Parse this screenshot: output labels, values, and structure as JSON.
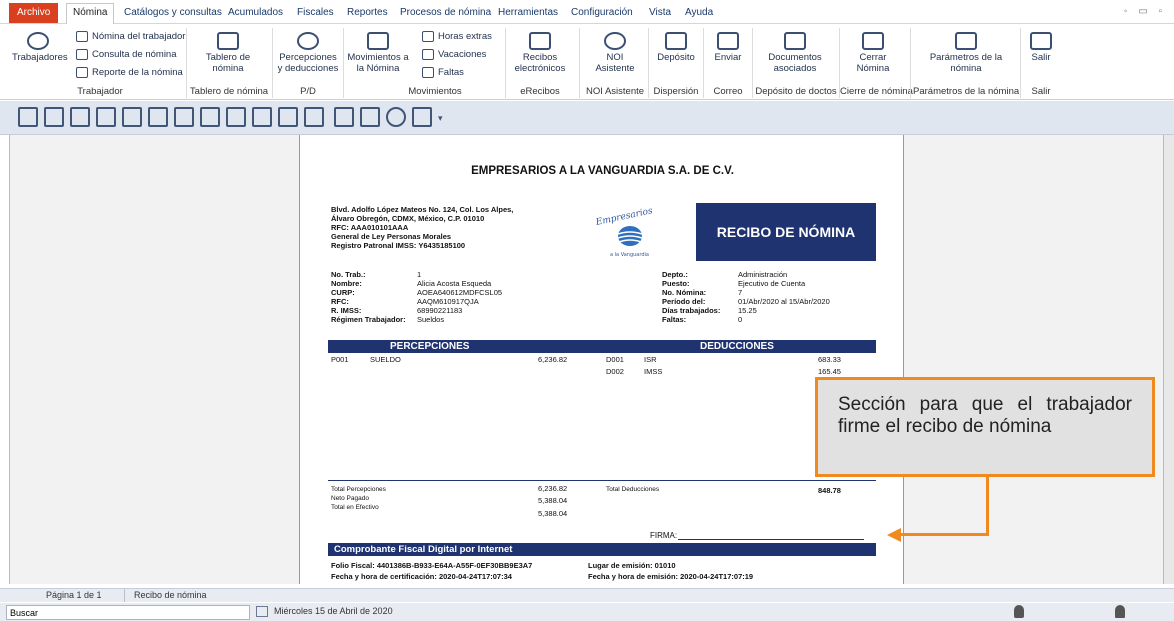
{
  "menu": {
    "archivo": "Archivo",
    "items": [
      "Nómina",
      "Catálogos y consultas",
      "Acumulados",
      "Fiscales",
      "Reportes",
      "Procesos de nómina",
      "Herramientas",
      "Configuración",
      "Vista",
      "Ayuda"
    ]
  },
  "ribbon": {
    "trabajadores": "Trabajadores",
    "nomina_trabajador": "Nómina del trabajador",
    "consulta_nomina": "Consulta de nómina",
    "reporte_nomina": "Reporte de la nómina",
    "group_trabajador": "Trabajador",
    "tablero": "Tablero de nómina",
    "group_tablero": "Tablero de nómina",
    "percepciones": "Percepciones y deducciones",
    "group_pd": "P/D",
    "movimientos": "Movimientos a la Nómina",
    "horas_extras": "Horas extras",
    "vacaciones": "Vacaciones",
    "faltas": "Faltas",
    "group_movimientos": "Movimientos",
    "recibos": "Recibos electrónicos",
    "group_erecibos": "eRecibos",
    "noi": "NOI Asistente",
    "group_noi": "NOI Asistente",
    "deposito": "Depósito",
    "group_dispersion": "Dispersión",
    "enviar": "Enviar",
    "group_correo": "Correo",
    "documentos": "Documentos asociados",
    "group_docs": "Depósito de doctos",
    "cerrar": "Cerrar Nómina",
    "group_cierre": "Cierre de nómina",
    "parametros": "Parámetros de la nómina",
    "group_param": "Parámetros de la nómina",
    "salir": "Salir",
    "group_salir": "Salir"
  },
  "receipt": {
    "company": "EMPRESARIOS A LA VANGUARDIA S.A. DE C.V.",
    "address1": "Blvd. Adolfo López Mateos No. 124, Col. Los Alpes,",
    "address2": "Álvaro Obregón, CDMX, México, C.P. 01010",
    "rfc_company": "RFC: AAA010101AAA",
    "regimen_company": "General de Ley Personas Morales",
    "registro": "Registro Patronal IMSS: Y6435185100",
    "logo_text": "Empresarios",
    "logo_sub": "a la Vanguardia",
    "title": "RECIBO DE NÓMINA",
    "left_labels": [
      "No. Trab.:",
      "Nombre:",
      "CURP:",
      "RFC:",
      "R. IMSS:",
      "Régimen Trabajador:"
    ],
    "left_values": [
      "1",
      "Alicia Acosta Esqueda",
      "AOEA640612MDFCSL05",
      "AAQM610917QJA",
      "68990221183",
      "Sueldos"
    ],
    "right_labels": [
      "Depto.:",
      "Puesto:",
      "No. Nómina:",
      "Período del:",
      "Días trabajados:",
      "Faltas:"
    ],
    "right_values": [
      "Administración",
      "Ejecutivo de Cuenta",
      "7",
      "01/Abr/2020 al 15/Abr/2020",
      "15.25",
      "0"
    ],
    "percepciones_header": "PERCEPCIONES",
    "deducciones_header": "DEDUCCIONES",
    "percepciones": [
      {
        "code": "P001",
        "name": "SUELDO",
        "amount": "6,236.82"
      }
    ],
    "deducciones": [
      {
        "code": "D001",
        "name": "ISR",
        "amount": "683.33"
      },
      {
        "code": "D002",
        "name": "IMSS",
        "amount": "165.45"
      }
    ],
    "total_percepciones_label": "Total Percepciones",
    "total_percepciones": "6,236.82",
    "neto_label": "Neto Pagado",
    "neto": "5,388.04",
    "efectivo_label": "Total en Efectivo",
    "efectivo": "5,388.04",
    "total_deducciones_label": "Total Deducciones",
    "total_deducciones": "848.78",
    "firma": "FIRMA:",
    "cfdi_header": "Comprobante Fiscal Digital por Internet",
    "folio": "Folio Fiscal: 4401386B-B933-E64A-A55F-0EF30BB9E3A7",
    "lugar": "Lugar de emisión: 01010",
    "cert": "Fecha y hora de certificación: 2020-04-24T17:07:34",
    "emision": "Fecha y hora de emisión: 2020-04-24T17:07:19"
  },
  "callout": "Sección para que el trabajador firme el recibo de nómina",
  "status": {
    "page": "Página 1 de 1",
    "doc": "Recibo de nómina",
    "search": "Buscar",
    "date": "Miércoles 15 de Abril de 2020"
  },
  "colors": {
    "accent": "#f08a1e",
    "navy": "#1f3370",
    "archivo": "#d8401f"
  }
}
